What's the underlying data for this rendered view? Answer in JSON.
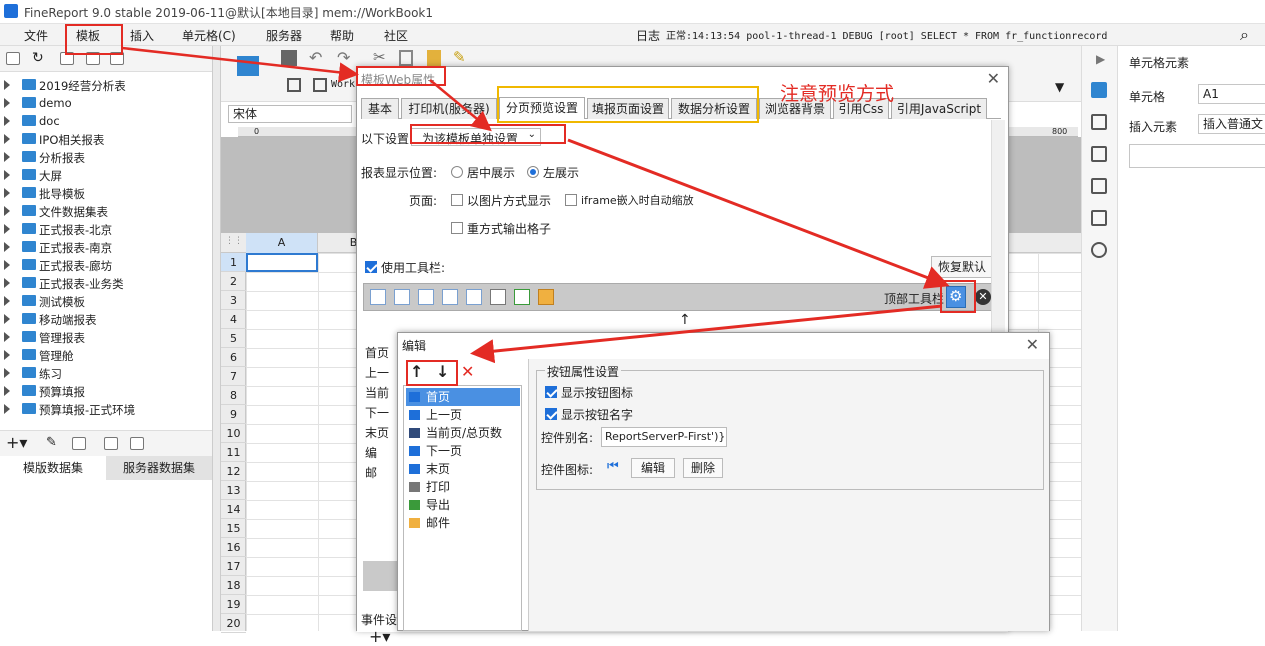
{
  "window": {
    "title": "FineReport 9.0 stable 2019-06-11@默认[本地目录]    mem://WorkBook1"
  },
  "menu": [
    "文件",
    "模板",
    "插入",
    "单元格(C)",
    "服务器",
    "帮助",
    "社区"
  ],
  "log": {
    "label": "日志",
    "text": "正常:14:13:54 pool-1-thread-1 DEBUG [root] SELECT * FROM fr_functionrecord"
  },
  "tree": [
    "2019经营分析表",
    "demo",
    "doc",
    "IPO相关报表",
    "分析报表",
    "大屏",
    "批导模板",
    "文件数据集表",
    "正式报表-北京",
    "正式报表-南京",
    "正式报表-廊坊",
    "正式报表-业务类",
    "测试模板",
    "移动端报表",
    "管理报表",
    "管理舱",
    "练习",
    "预算填报",
    "预算填报-正式环境"
  ],
  "datasets": {
    "template": "模版数据集",
    "server": "服务器数据集"
  },
  "editor": {
    "font": "宋体",
    "tab": "Work",
    "ruler": {
      "start": "0",
      "end": "800"
    },
    "columns": [
      "A",
      "B"
    ],
    "rows": [
      "1",
      "2",
      "3",
      "4",
      "5",
      "6",
      "7",
      "8",
      "9",
      "10",
      "11",
      "12",
      "13",
      "14",
      "15",
      "16",
      "17",
      "18",
      "19",
      "20"
    ]
  },
  "right_panel": {
    "title": "单元格元素",
    "cell_label": "单元格",
    "cell_value": "A1",
    "insert_label": "插入元素",
    "insert_value": "插入普通文"
  },
  "web_dialog": {
    "title": "模板Web属性",
    "tabs": [
      "基本",
      "打印机(服务器)",
      "分页预览设置",
      "填报页面设置",
      "数据分析设置",
      "浏览器背景",
      "引用Css",
      "引用JavaScript"
    ],
    "active_tab": 2,
    "settings_label": "以下设置",
    "settings_value": "为该模板单独设置",
    "position_label": "报表显示位置:",
    "position_center": "居中展示",
    "position_left": "左展示",
    "page_label": "页面:",
    "opt_image": "以图片方式显示",
    "opt_iframe": "iframe嵌入时自动缩放",
    "opt_repeat": "重方式输出格子",
    "use_toolbar": "使用工具栏:",
    "restore": "恢复默认",
    "top_toolbar": "顶部工具栏",
    "list_items": [
      "首页",
      "上一",
      "当前",
      "下一",
      "末页",
      "编",
      "邮"
    ],
    "event_label": "事件设"
  },
  "annotation": "注意预览方式",
  "edit_dialog": {
    "title": "编辑",
    "items": [
      "首页",
      "上一页",
      "当前页/总页数",
      "下一页",
      "末页",
      "打印",
      "导出",
      "邮件"
    ],
    "group": "按钮属性设置",
    "show_icon": "显示按钮图标",
    "show_name": "显示按钮名字",
    "alias_label": "控件别名:",
    "alias_value": "ReportServerP-First')}",
    "icon_label": "控件图标:",
    "edit_btn": "编辑",
    "delete_btn": "删除"
  },
  "colors": {
    "accent": "#1e6fd9",
    "red": "#e32b24",
    "orange": "#f0b800"
  }
}
